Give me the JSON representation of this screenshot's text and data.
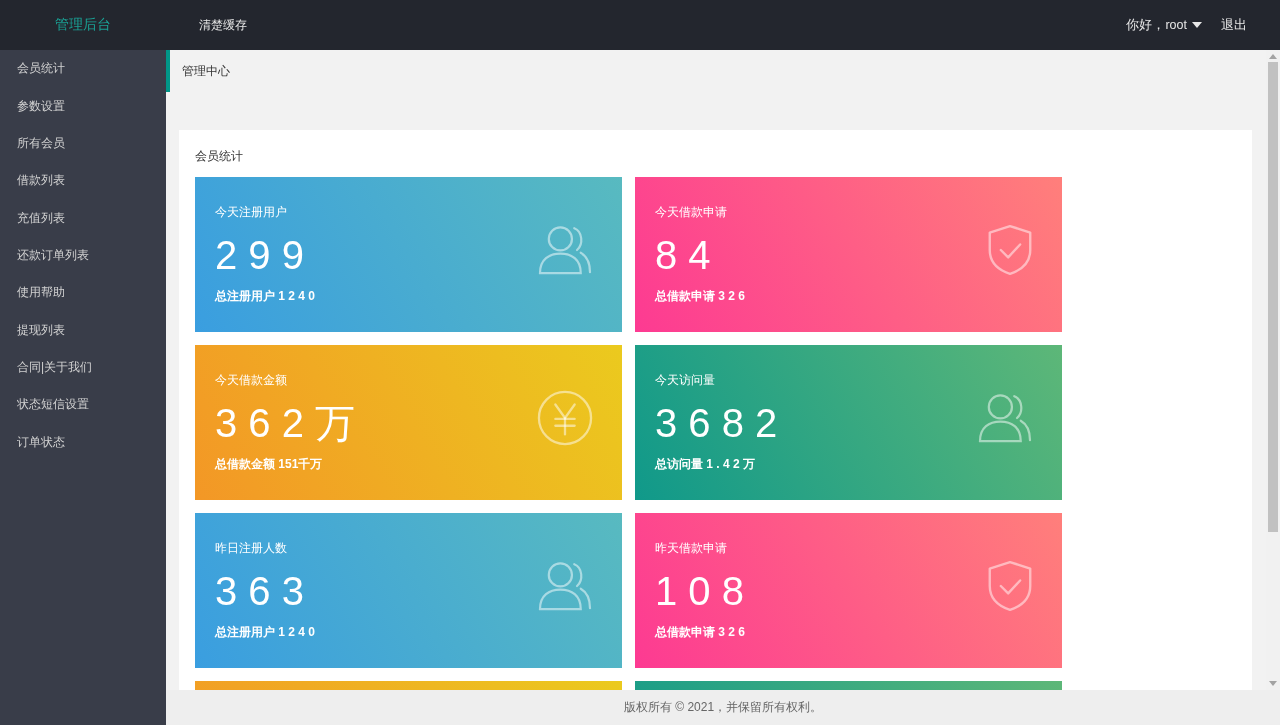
{
  "header": {
    "logo": "管理后台",
    "nav": [
      "清楚缓存"
    ],
    "user_menu": "你好，root",
    "logout": "退出"
  },
  "sidebar": {
    "items": [
      {
        "label": "会员统计"
      },
      {
        "label": "参数设置"
      },
      {
        "label": "所有会员"
      },
      {
        "label": "借款列表"
      },
      {
        "label": "充值列表"
      },
      {
        "label": "还款订单列表"
      },
      {
        "label": "使用帮助"
      },
      {
        "label": "提现列表"
      },
      {
        "label": "合同|关于我们"
      },
      {
        "label": "状态短信设置"
      },
      {
        "label": "订单状态"
      }
    ]
  },
  "breadcrumb": "管理中心",
  "panel": {
    "title": "会员统计",
    "cards": [
      {
        "kind": "registrations",
        "label": "今天注册用户",
        "value": "2 9 9",
        "sub": "总注册用户 1 2 4 0"
      },
      {
        "kind": "applications",
        "label": "今天借款申请",
        "value": "8 4",
        "sub": "总借款申请 3 2 6"
      },
      {
        "kind": "amount",
        "label": "今天借款金额",
        "value": "3 6 2 万",
        "sub": "总借款金额 151千万"
      },
      {
        "kind": "visits",
        "label": "今天访问量",
        "value": "3 6 8 2",
        "sub": "总访问量 1 . 4 2 万"
      },
      {
        "kind": "registrations",
        "label": "昨日注册人数",
        "value": "3 6 3",
        "sub": "总注册用户 1 2 4 0"
      },
      {
        "kind": "applications",
        "label": "昨天借款申请",
        "value": "1 0 8",
        "sub": "总借款申请 3 2 6"
      },
      {
        "kind": "amount"
      },
      {
        "kind": "visits"
      }
    ]
  },
  "footer": "版权所有 © 2021，并保留所有权利。"
}
